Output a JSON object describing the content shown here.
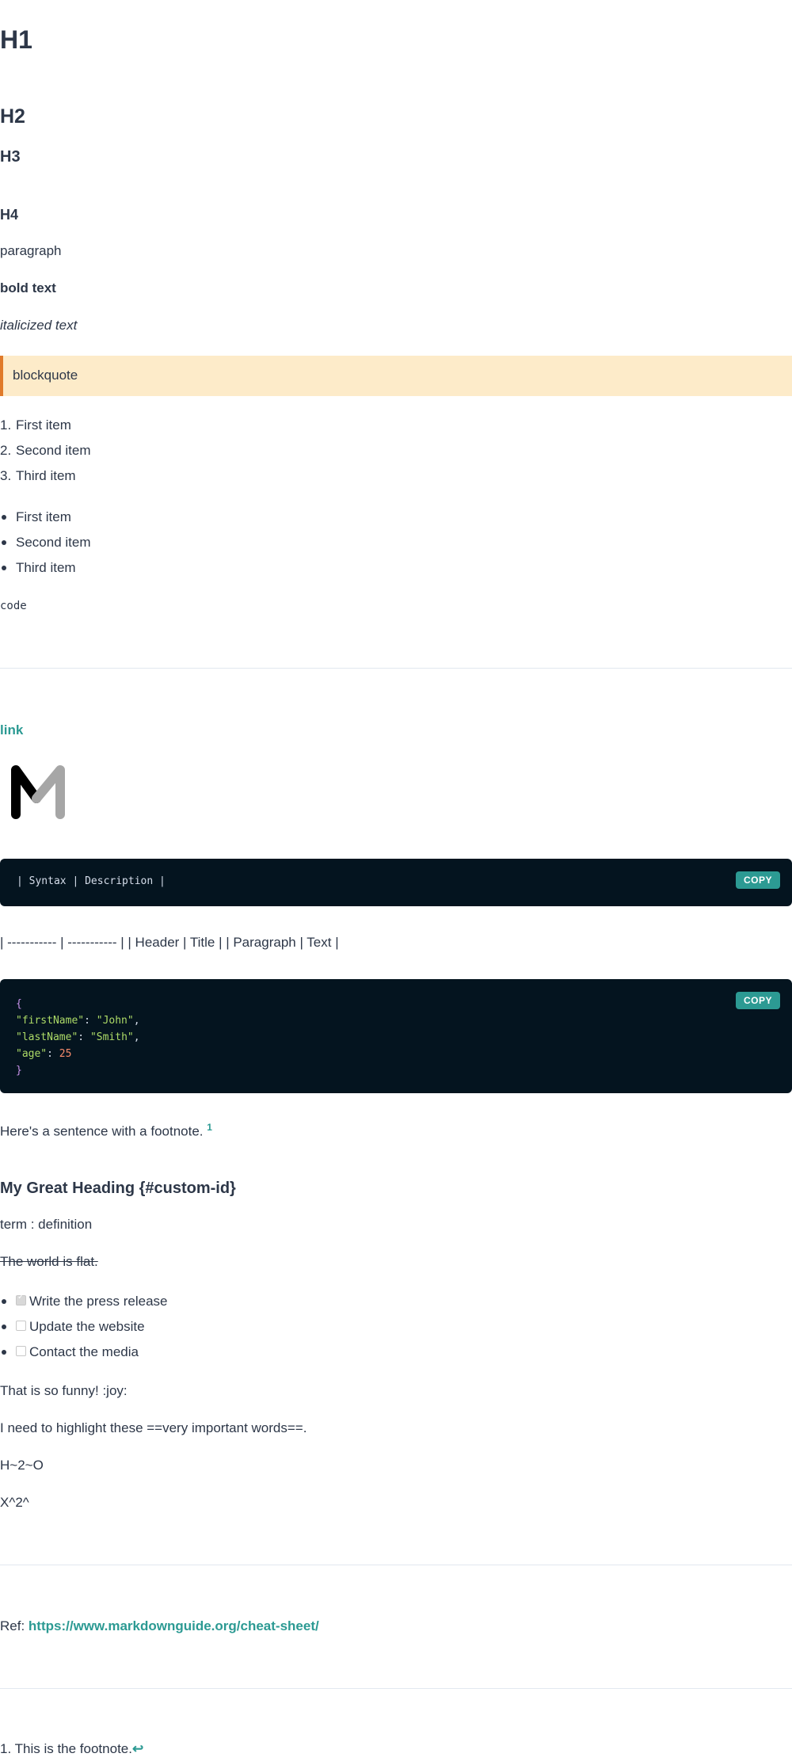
{
  "headings": {
    "h1": "H1",
    "h2": "H2",
    "h3": "H3",
    "h4": "H4"
  },
  "paragraph": "paragraph",
  "bold_text": "bold text",
  "italic_text": "italicized text",
  "blockquote": "blockquote",
  "ordered_list": [
    {
      "num": "1.",
      "text": "First item"
    },
    {
      "num": "2.",
      "text": "Second item"
    },
    {
      "num": "3.",
      "text": "Third item"
    }
  ],
  "unordered_list": [
    "First item",
    "Second item",
    "Third item"
  ],
  "inline_code": "code",
  "link_text": "link",
  "logo_letter": "M",
  "code_block_1": {
    "text": "| Syntax | Description |",
    "copy_label": "COPY"
  },
  "table_text": "| ----------- | ----------- | | Header | Title | | Paragraph | Text |",
  "code_block_2": {
    "copy_label": "COPY",
    "open": "{",
    "line1_key": "\"firstName\"",
    "line1_val": "\"John\"",
    "line2_key": "\"lastName\"",
    "line2_val": "\"Smith\"",
    "line3_key": "\"age\"",
    "line3_val": "25",
    "close": "}"
  },
  "footnote_sentence": "Here's a sentence with a footnote.",
  "footnote_ref": "1",
  "custom_heading": "My Great Heading {#custom-id}",
  "definition": "term : definition",
  "strikethrough": "The world is flat.",
  "tasks": [
    {
      "text": "Write the press release",
      "checked": true
    },
    {
      "text": "Update the website",
      "checked": false
    },
    {
      "text": "Contact the media",
      "checked": false
    }
  ],
  "emoji_text": "That is so funny! :joy:",
  "highlight_text": "I need to highlight these ==very important words==.",
  "subscript_text": "H~2~O",
  "superscript_text": "X^2^",
  "ref_label": "Ref:",
  "ref_url": "https://www.markdownguide.org/cheat-sheet/",
  "footnote": {
    "num": "1.",
    "text": "This is the footnote.",
    "backref": "↩"
  }
}
